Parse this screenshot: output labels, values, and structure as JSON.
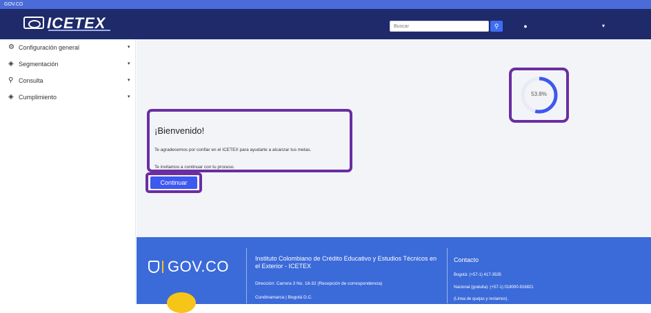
{
  "gov_bar": {
    "label": "GOV.CO"
  },
  "header": {
    "brand": "ICETEX",
    "search_placeholder": "Buscar",
    "search_icon": "search-icon",
    "bell_icon": "bell-icon"
  },
  "sidebar": {
    "items": [
      {
        "label": "Configuración general",
        "icon": "gears-icon"
      },
      {
        "label": "Segmentación",
        "icon": "cubes-icon"
      },
      {
        "label": "Consulta",
        "icon": "search-icon"
      },
      {
        "label": "Cumplimiento",
        "icon": "cubes-icon"
      }
    ]
  },
  "welcome": {
    "title": "¡Bienvenido!",
    "line1": "Te agradecemos por confiar en el ICETEX para ayudarte a alcanzar tus metas.",
    "line2": "Te invitamos a continuar con tu proceso.",
    "button": "Continuar"
  },
  "progress": {
    "label": "53.8%",
    "value": 0.538
  },
  "footer": {
    "gov_logo": "GOV.CO",
    "institution": "Instituto Colombiano de Crédito Educativo y Estudios Técnicos en el Exterior - ICETEX",
    "address": "Dirección: Carrera 3 No. 18-32 (Recepción de correspondencia)",
    "city": "Cundinamarca | Bogotá D.C.",
    "contact_title": "Contacto",
    "phone_bogota": "Bogotá: (+57-1) 417-3535",
    "phone_national": "Nacional (gratuita): (+57-1) 018000-916821",
    "complaints": "(Línea de quejas y reclamos)."
  },
  "colors": {
    "nav": "#1f2a6b",
    "accent": "#3d59f0",
    "highlight": "#6a2da2",
    "footer": "#3b6ad9"
  }
}
